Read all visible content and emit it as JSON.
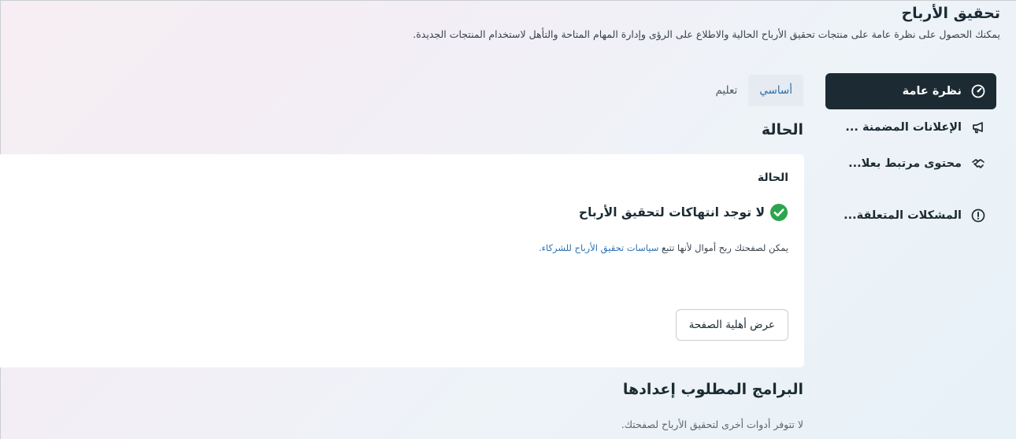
{
  "page": {
    "title": "تحقيق الأرباح",
    "subtitle": "يمكنك الحصول على نظرة عامة على منتجات تحقيق الأرباح الحالية والاطلاع على الرؤى وإدارة المهام المتاحة والتأهل لاستخدام المنتجات الجديدة."
  },
  "sidebar": {
    "items": [
      {
        "label": "نظرة عامة",
        "icon": "gauge-icon",
        "active": true
      },
      {
        "label": "الإعلانات المضمنة ...",
        "icon": "megaphone-icon",
        "active": false
      },
      {
        "label": "محتوى مرتبط بعلا...",
        "icon": "handshake-icon",
        "active": false
      },
      {
        "label": "المشكلات المتعلقة...",
        "icon": "alert-circle-icon",
        "active": false
      }
    ]
  },
  "tabs": [
    {
      "label": "أساسي",
      "active": true
    },
    {
      "label": "تعليم",
      "active": false
    }
  ],
  "status_section": {
    "title": "الحالة",
    "card": {
      "label": "الحالة",
      "status_text": "لا توجد انتهاكات لتحقيق الأرباح",
      "status_icon": "check-circle-icon",
      "description_prefix": "يمكن لصفحتك ربح أموال لأنها تتبع ",
      "description_link": "سياسات تحقيق الأرباح للشركاء.",
      "button_label": "عرض أهلية الصفحة"
    }
  },
  "programs_section": {
    "title": "البرامج المطلوب إعدادها",
    "description": "لا تتوفر أدوات أخرى لتحقيق الأرباح لصفحتك."
  },
  "colors": {
    "active_nav_bg": "#1c2b33",
    "link": "#2a72b3",
    "success_green": "#2da44e"
  }
}
